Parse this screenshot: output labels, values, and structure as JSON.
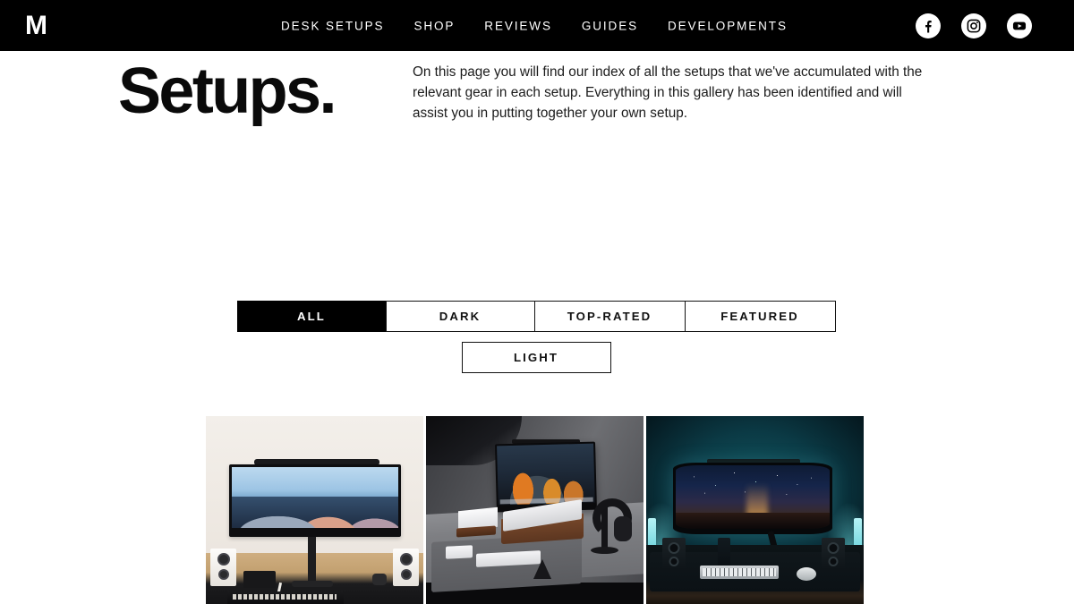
{
  "header": {
    "logo_text": "M",
    "nav": [
      {
        "label": "DESK SETUPS"
      },
      {
        "label": "SHOP"
      },
      {
        "label": "REVIEWS"
      },
      {
        "label": "GUIDES"
      },
      {
        "label": "DEVELOPMENTS"
      }
    ],
    "social": [
      {
        "name": "facebook-icon"
      },
      {
        "name": "instagram-icon"
      },
      {
        "name": "youtube-icon"
      }
    ],
    "background_color": "#000000",
    "text_color": "#ffffff"
  },
  "hero": {
    "title": "Setups.",
    "description": "On this page you will find our index of all the setups that we've accumulated with the relevant gear in each setup. Everything in this gallery has been identified and will assist you in putting together your own setup."
  },
  "filters": {
    "active": "ALL",
    "row1": [
      {
        "label": "ALL",
        "active": true
      },
      {
        "label": "DARK",
        "active": false
      },
      {
        "label": "TOP-RATED",
        "active": false
      },
      {
        "label": "FEATURED",
        "active": false
      }
    ],
    "row2": [
      {
        "label": "LIGHT",
        "active": false
      }
    ],
    "active_bg": "#000000",
    "active_fg": "#ffffff",
    "inactive_bg": "#ffffff",
    "inactive_fg": "#111111"
  },
  "gallery": {
    "items": [
      {
        "name": "setup-photo-light-ultrawide",
        "alt": "Light desk setup with ultrawide monitor, mountain wallpaper and white bookshelf speakers"
      },
      {
        "name": "setup-photo-grey-minimal",
        "alt": "Grey minimal desk setup with monitor, wooden laptop stand, headphone stand and desk mat"
      },
      {
        "name": "setup-photo-dark-ambient",
        "alt": "Dark ambient teal-lit setup with curved ultrawide monitor, speakers and mechanical keyboard"
      }
    ]
  }
}
